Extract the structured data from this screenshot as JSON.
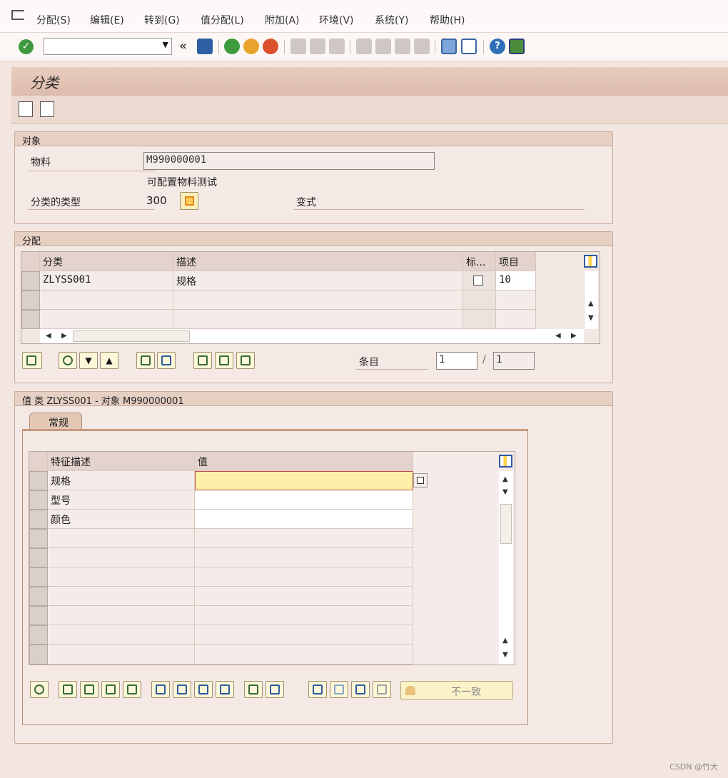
{
  "menu": {
    "items": [
      {
        "label": "分配(S)"
      },
      {
        "label": "编辑(E)"
      },
      {
        "label": "转到(G)"
      },
      {
        "label": "值分配(L)"
      },
      {
        "label": "附加(A)"
      },
      {
        "label": "环境(V)"
      },
      {
        "label": "系统(Y)"
      },
      {
        "label": "帮助(H)"
      }
    ]
  },
  "toolbar": {
    "command_value": "",
    "collapse_glyph": "«"
  },
  "page": {
    "title": "分类"
  },
  "object_section": {
    "title": "对象",
    "material_label": "物料",
    "material_value": "M990000001",
    "material_desc": "可配置物料测试",
    "class_type_label": "分类的类型",
    "class_type_value": "300",
    "variant_label": "变式"
  },
  "assign_section": {
    "title": "分配",
    "columns": {
      "class": "分类",
      "desc": "描述",
      "std": "标...",
      "item": "项目"
    },
    "rows": [
      {
        "class": "ZLYSS001",
        "desc": "规格",
        "item": "10"
      }
    ],
    "entry_label": "条目",
    "entry_value": "1",
    "entry_sep": "/",
    "entry_total": "1"
  },
  "value_section": {
    "title": "值 类 ZLYSS001 - 对象 M990000001",
    "tab_general": "常规",
    "columns": {
      "char": "特征描述",
      "value": "值"
    },
    "rows": [
      {
        "char": "规格",
        "value": ""
      },
      {
        "char": "型号",
        "value": ""
      },
      {
        "char": "颜色",
        "value": ""
      }
    ],
    "inconsistent_label": "不一致"
  },
  "watermark": "CSDN @竹大"
}
